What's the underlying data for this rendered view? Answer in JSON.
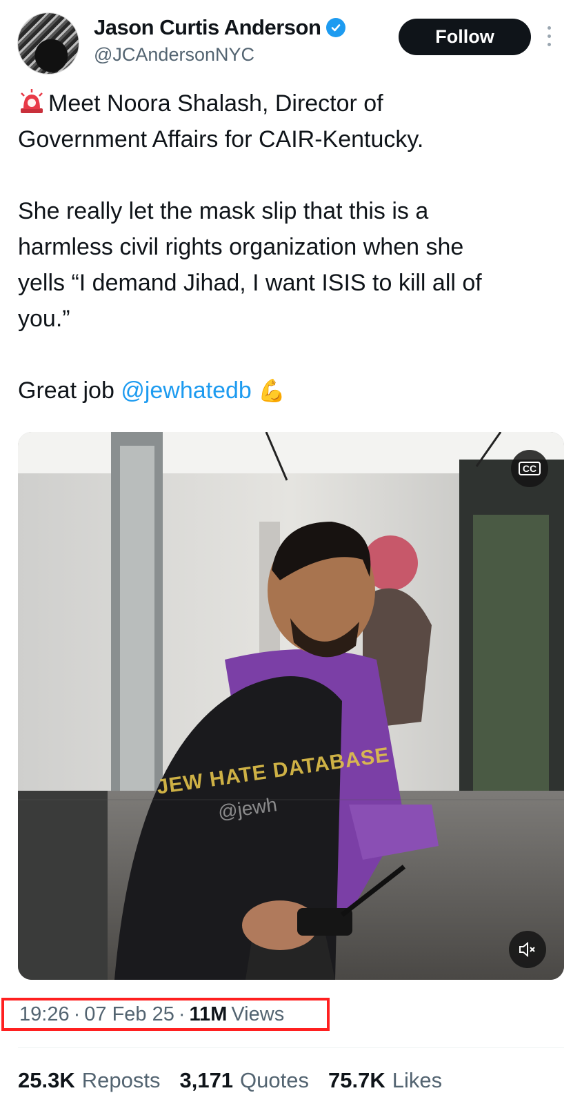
{
  "author": {
    "name": "Jason Curtis Anderson",
    "handle": "@JCAndersonNYC",
    "verified": true
  },
  "follow_label": "Follow",
  "tweet": {
    "line1": "Meet Noora Shalash, Director of\nGovernment Affairs for CAIR-Kentucky.",
    "line2": "She really let the mask slip that this is a\nharmless civil rights organization when she\nyells “I demand Jihad, I want ISIS to kill all of\nyou.”",
    "great_job": "Great job ",
    "mention": "@jewhatedb",
    "emoji_flex": "💪",
    "emoji_siren": "siren-icon"
  },
  "media": {
    "watermark_line1": "JEW HATE DATABASE",
    "watermark_line2": "@jewh",
    "cc_label": "CC",
    "mute_icon": "speaker-muted-icon"
  },
  "meta": {
    "time": "19:26",
    "sep": "·",
    "date": "07 Feb 25",
    "views_count": "11M",
    "views_label": "Views"
  },
  "stats": {
    "reposts_count": "25.3K",
    "reposts_label": "Reposts",
    "quotes_count": "3,171",
    "quotes_label": "Quotes",
    "likes_count": "75.7K",
    "likes_label": "Likes"
  },
  "colors": {
    "accent": "#1d9bf0",
    "highlight_box": "#ff2020"
  }
}
